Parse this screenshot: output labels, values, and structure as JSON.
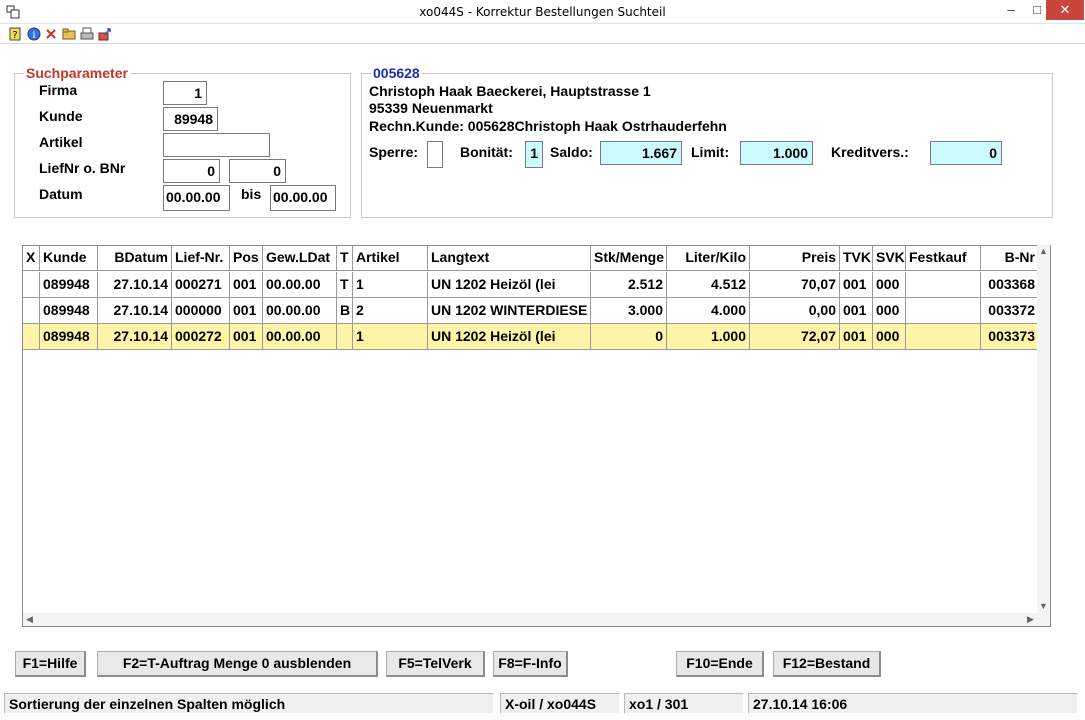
{
  "window": {
    "title": "xo044S - Korrektur Bestellungen Suchteil",
    "minimize": "–",
    "maximize": "□",
    "close": "✕"
  },
  "toolbar": {
    "icons": [
      "help-icon",
      "info-icon",
      "delete-icon",
      "folder-icon",
      "print-icon",
      "export-icon"
    ]
  },
  "search": {
    "title": "Suchparameter",
    "firma_label": "Firma",
    "firma_value": "1",
    "kunde_label": "Kunde",
    "kunde_value": "89948",
    "artikel_label": "Artikel",
    "artikel_value": "",
    "liefnr_label": "LiefNr o. BNr",
    "liefnr_value": "0",
    "bnr_value": "0",
    "datum_label": "Datum",
    "datum_from": "00.00.00",
    "bis_label": "bis",
    "datum_to": "00.00.00"
  },
  "customer": {
    "number": "005628",
    "line1": "Christoph Haak Baeckerei, Hauptstrasse 1",
    "line2": "95339 Neuenmarkt",
    "line3": "Rechn.Kunde:  005628Christoph Haak Ostrhauderfehn",
    "sperre_label": "Sperre:",
    "sperre_value": "",
    "bonitaet_label": "Bonität:",
    "bonitaet_value": "1",
    "saldo_label": "Saldo:",
    "saldo_value": "1.667",
    "limit_label": "Limit:",
    "limit_value": "1.000",
    "kreditvers_label": "Kreditvers.:",
    "kreditvers_value": "0"
  },
  "table": {
    "headers": [
      "X",
      "Kunde",
      "BDatum",
      "Lief-Nr.",
      "Pos",
      "Gew.LDat",
      "T",
      "Artikel",
      "Langtext",
      "Stk/Menge",
      "Liter/Kilo",
      "Preis",
      "TVK",
      "SVK",
      "Festkauf",
      "B-Nr"
    ],
    "rows": [
      [
        "",
        "089948",
        "27.10.14",
        "000271",
        "001",
        "00.00.00",
        "T",
        "1",
        "UN 1202 Heizöl (lei",
        "2.512",
        "4.512",
        "70,07",
        "001",
        "000",
        "",
        "003368"
      ],
      [
        "",
        "089948",
        "27.10.14",
        "000000",
        "001",
        "00.00.00",
        "B",
        "2",
        "UN 1202 WINTERDIESE",
        "3.000",
        "4.000",
        "0,00",
        "001",
        "000",
        "",
        "003372"
      ],
      [
        "",
        "089948",
        "27.10.14",
        "000272",
        "001",
        "00.00.00",
        "",
        "1",
        "UN 1202 Heizöl (lei",
        "0",
        "1.000",
        "72,07",
        "001",
        "000",
        "",
        "003373"
      ]
    ]
  },
  "buttons": {
    "f1": "F1=Hilfe",
    "f2": "F2=T-Auftrag Menge 0 ausblenden",
    "f5": "F5=TelVerk",
    "f8": "F8=F-Info",
    "f10": "F10=Ende",
    "f12": "F12=Bestand"
  },
  "statusbar": {
    "message": "Sortierung der einzelnen Spalten möglich",
    "program": "X-oil / xo044S",
    "user": "xo1 / 301",
    "datetime": "27.10.14 16:06"
  }
}
